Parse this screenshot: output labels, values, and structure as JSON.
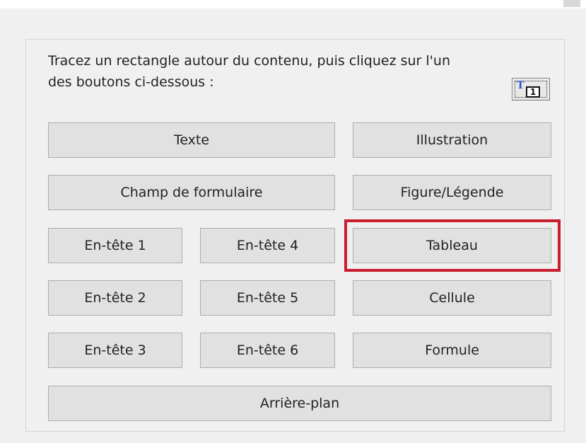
{
  "instructions": "Tracez un rectangle autour du contenu, puis cliquez sur l'un\ndes boutons ci-dessous :",
  "instruction_icon": {
    "name": "text-region-icon",
    "t_glyph": "T",
    "number_glyph": "1"
  },
  "buttons": {
    "texte": "Texte",
    "illustration": "Illustration",
    "champ_formulaire": "Champ de formulaire",
    "figure_legende": "Figure/Légende",
    "entete1": "En-tête 1",
    "entete4": "En-tête 4",
    "tableau": "Tableau",
    "entete2": "En-tête 2",
    "entete5": "En-tête 5",
    "cellule": "Cellule",
    "entete3": "En-tête 3",
    "entete6": "En-tête 6",
    "formule": "Formule",
    "arriere_plan": "Arrière-plan"
  },
  "highlight_color": "#c81e2e"
}
